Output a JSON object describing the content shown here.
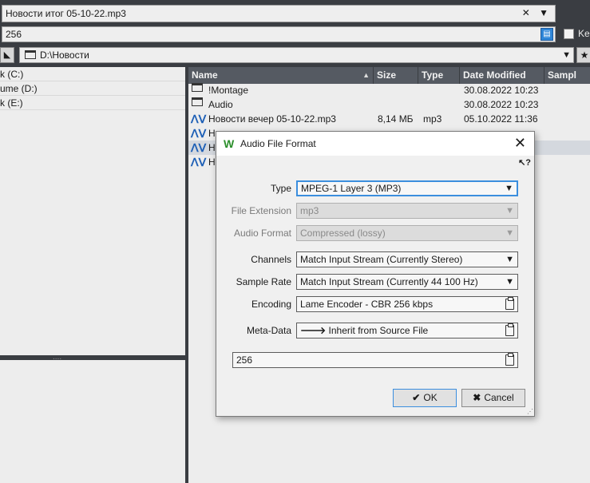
{
  "toolbar": {
    "filename": "Новости итог 05-10-22.mp3",
    "filename_controls": "✕ ▼",
    "preset": "256",
    "checkbox_label": "Ke",
    "path": "D:\\Новости"
  },
  "drives": [
    {
      "label": "k (C:)"
    },
    {
      "label": "ume (D:)"
    },
    {
      "label": "k (E:)"
    }
  ],
  "splitter_grip": "....",
  "file_table": {
    "columns": [
      "Name",
      "Size",
      "Type",
      "Date Modified",
      "Sampl"
    ],
    "rows": [
      {
        "name": "!Montage",
        "size": "",
        "type": "",
        "date": "30.08.2022 10:23",
        "kind": "folder"
      },
      {
        "name": "Audio",
        "size": "",
        "type": "",
        "date": "30.08.2022 10:23",
        "kind": "folder"
      },
      {
        "name": "Новости вечер 05-10-22.mp3",
        "size": "8,14 МБ",
        "type": "mp3",
        "date": "05.10.2022 11:36",
        "kind": "audio"
      },
      {
        "name": "Н",
        "size": "",
        "type": "",
        "date": "",
        "kind": "audio"
      },
      {
        "name": "Н",
        "size": "",
        "type": "",
        "date": "",
        "kind": "audio"
      },
      {
        "name": "Н",
        "size": "",
        "type": "",
        "date": "",
        "kind": "audio"
      }
    ]
  },
  "dialog": {
    "title": "Audio File Format",
    "help": "↖?",
    "fields": {
      "type": {
        "label": "Type",
        "value": "MPEG-1 Layer 3 (MP3)"
      },
      "extension": {
        "label": "File Extension",
        "value": "mp3"
      },
      "audio_format": {
        "label": "Audio Format",
        "value": "Compressed (lossy)"
      },
      "channels": {
        "label": "Channels",
        "value": "Match Input Stream (Currently Stereo)"
      },
      "sample_rate": {
        "label": "Sample Rate",
        "value": "Match Input Stream (Currently 44 100 Hz)"
      },
      "encoding": {
        "label": "Encoding",
        "value": "Lame Encoder - CBR 256 kbps"
      },
      "meta_data": {
        "label": "Meta-Data",
        "value": "Inherit from Source File"
      }
    },
    "preset_value": "256",
    "ok_label": "OK",
    "cancel_label": "Cancel"
  },
  "colors": {
    "background": "#3a3d42",
    "panel": "#ededed",
    "header": "#555a62",
    "accent": "#3b8ede",
    "wave_icon": "#1d5fb6"
  }
}
